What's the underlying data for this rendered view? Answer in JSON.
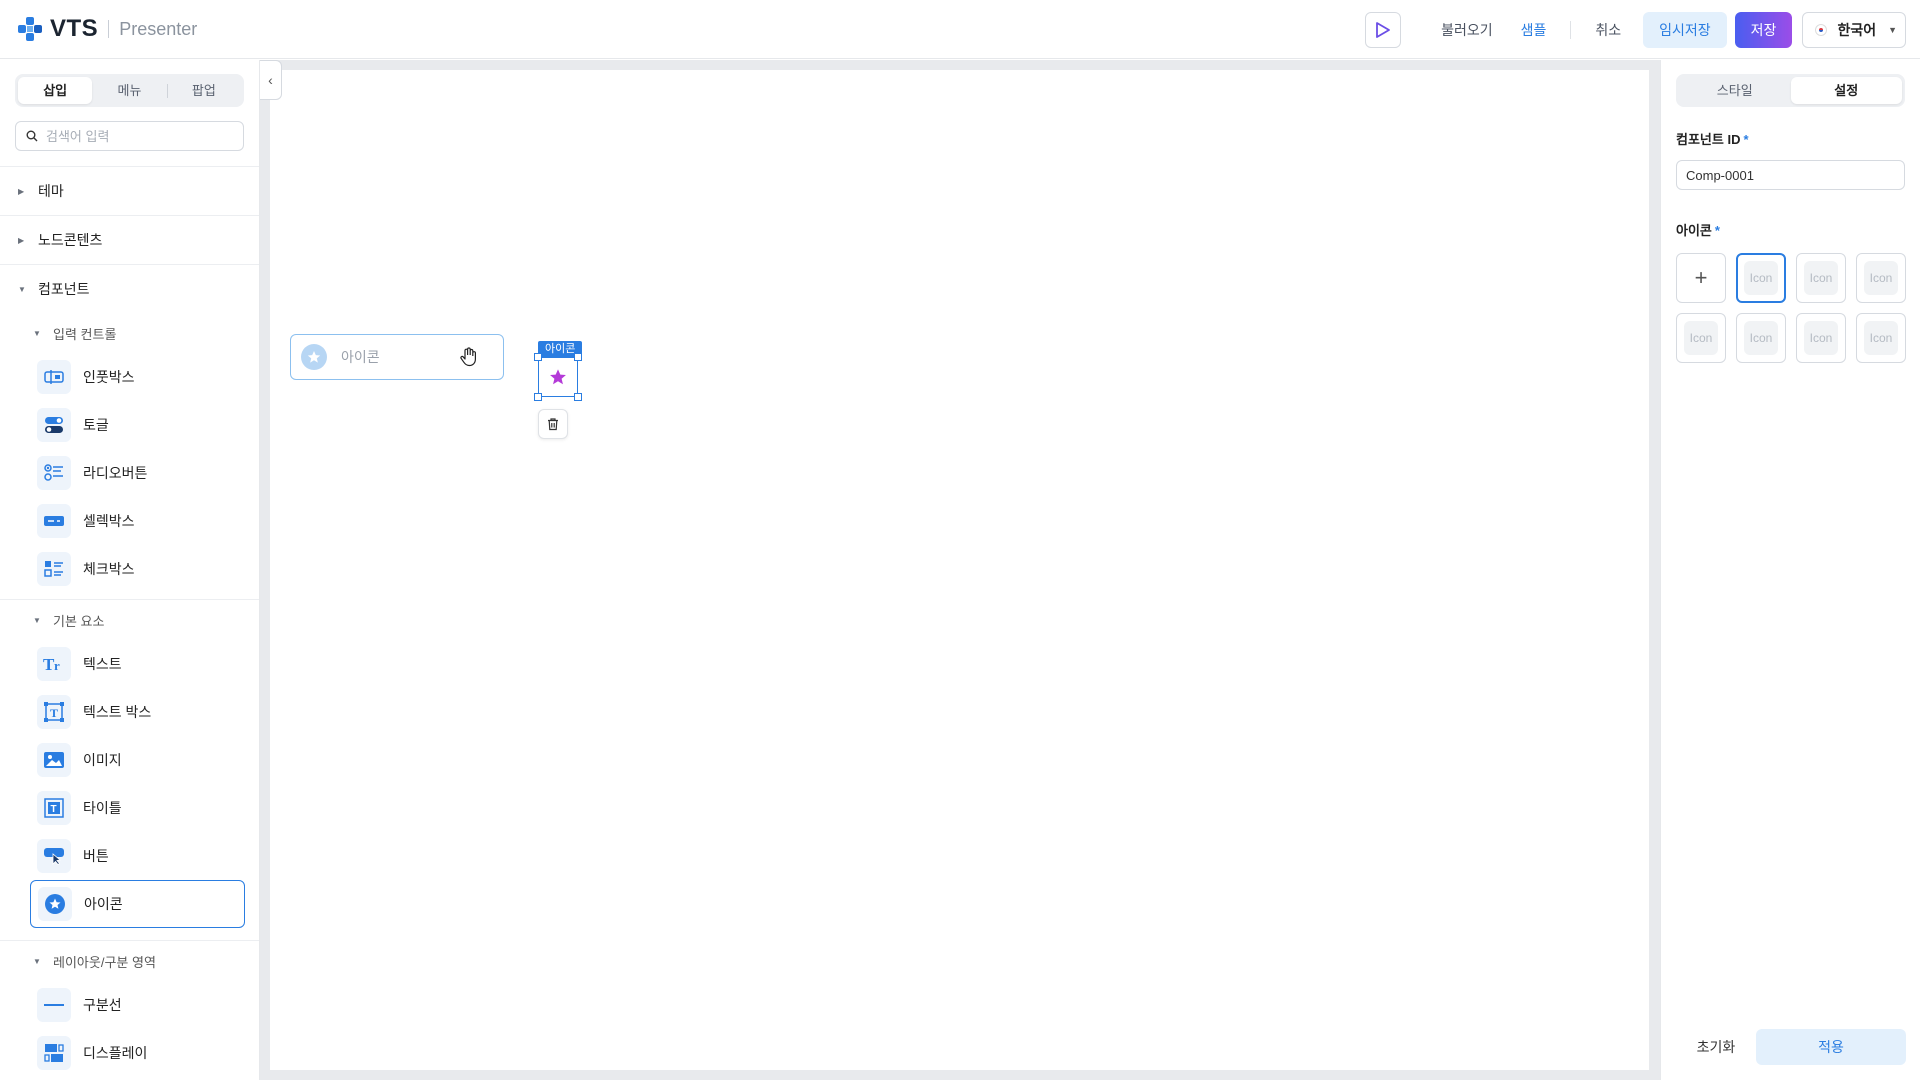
{
  "header": {
    "logo_text": "VTS",
    "logo_sub": "Presenter",
    "load_label": "불러오기",
    "sample_label": "샘플",
    "cancel_label": "취소",
    "temp_save_label": "임시저장",
    "save_label": "저장",
    "language_label": "한국어"
  },
  "left": {
    "tabs": [
      "삽입",
      "메뉴",
      "팝업"
    ],
    "search_placeholder": "검색어 입력",
    "groups": {
      "theme": "테마",
      "node_contents": "노드콘텐츠",
      "components": "컴포넌트"
    },
    "input_controls": {
      "title": "입력 컨트롤",
      "items": [
        "인풋박스",
        "토글",
        "라디오버튼",
        "셀렉박스",
        "체크박스"
      ]
    },
    "basic_elements": {
      "title": "기본 요소",
      "items": [
        "텍스트",
        "텍스트 박스",
        "이미지",
        "타이틀",
        "버튼",
        "아이콘"
      ]
    },
    "layout": {
      "title": "레이아웃/구분 영역",
      "items": [
        "구분선",
        "디스플레이"
      ]
    }
  },
  "canvas": {
    "input_comp_label": "아이콘",
    "selected_tag": "아이콘"
  },
  "right": {
    "tabs": [
      "스타일",
      "설정"
    ],
    "component_id_label": "컴포넌트 ID",
    "component_id_value": "Comp-0001",
    "icon_label": "아이콘",
    "required_mark": "*",
    "icon_placeholder": "Icon",
    "reset_label": "초기화",
    "apply_label": "적용"
  },
  "colors": {
    "accent": "#2a7de1",
    "star": "#b43ad8"
  }
}
